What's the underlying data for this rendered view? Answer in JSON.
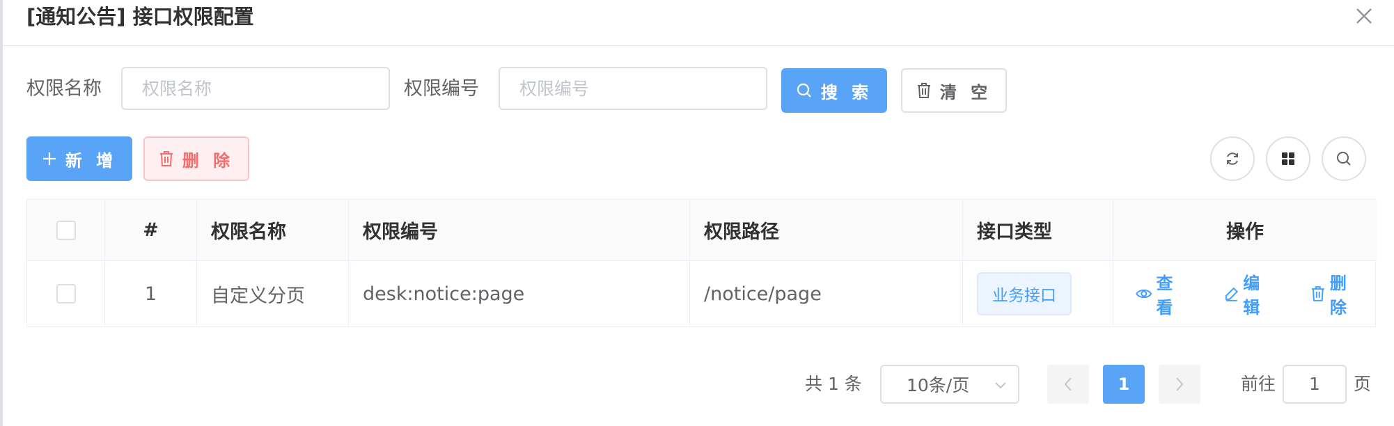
{
  "dialog": {
    "title": "[通知公告] 接口权限配置",
    "close_icon": "close-icon"
  },
  "search": {
    "name_label": "权限名称",
    "name_placeholder": "权限名称",
    "code_label": "权限编号",
    "code_placeholder": "权限编号",
    "search_button": "搜 索",
    "clear_button": "清 空"
  },
  "toolbar": {
    "add_button": "新 增",
    "delete_button": "删 除",
    "icons": [
      "refresh-icon",
      "columns-icon",
      "search-icon"
    ]
  },
  "table": {
    "columns": [
      "#",
      "权限名称",
      "权限编号",
      "权限路径",
      "接口类型",
      "操作"
    ],
    "rows": [
      {
        "index": "1",
        "name": "自定义分页",
        "code": "desk:notice:page",
        "path": "/notice/page",
        "type": "业务接口",
        "actions": [
          "查 看",
          "编 辑",
          "删 除"
        ]
      }
    ]
  },
  "pagination": {
    "total": "共 1 条",
    "page_size": "10条/页",
    "current_page": "1",
    "goto_prefix": "前往",
    "goto_value": "1",
    "goto_suffix": "页"
  },
  "colors": {
    "primary": "#5aa4f7",
    "link": "#409eff",
    "danger": "#f56c6c"
  }
}
